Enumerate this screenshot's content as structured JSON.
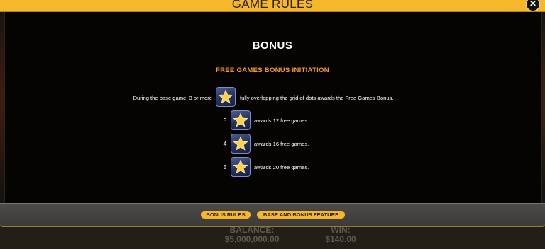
{
  "header": {
    "title": "GAME RULES",
    "close_glyph": "✕"
  },
  "content": {
    "section_title": "BONUS",
    "subtitle": "FREE GAMES BONUS INITIATION",
    "intro_before_icon": "During the base game, 3 or more",
    "intro_after_icon": "fully overlapping the grid of dots awards the Free Games Bonus.",
    "symbol_icon": "bonus-star-icon",
    "payouts": [
      {
        "count": "3",
        "text": "awards 12 free games."
      },
      {
        "count": "4",
        "text": "awards 16 free games."
      },
      {
        "count": "5",
        "text": "awards 20 free games."
      }
    ]
  },
  "footer_tabs": [
    {
      "label": "BONUS RULES"
    },
    {
      "label": "BASE AND BONUS FEATURE"
    }
  ],
  "bottom_bar": {
    "balance_label": "BALANCE:",
    "balance_value": "$5,000,000.00",
    "win_label": "WIN:",
    "win_value": "$140.00"
  },
  "colors": {
    "accent": "#f5b82c",
    "subtitle": "#f29a2a",
    "panel": "#050403"
  }
}
